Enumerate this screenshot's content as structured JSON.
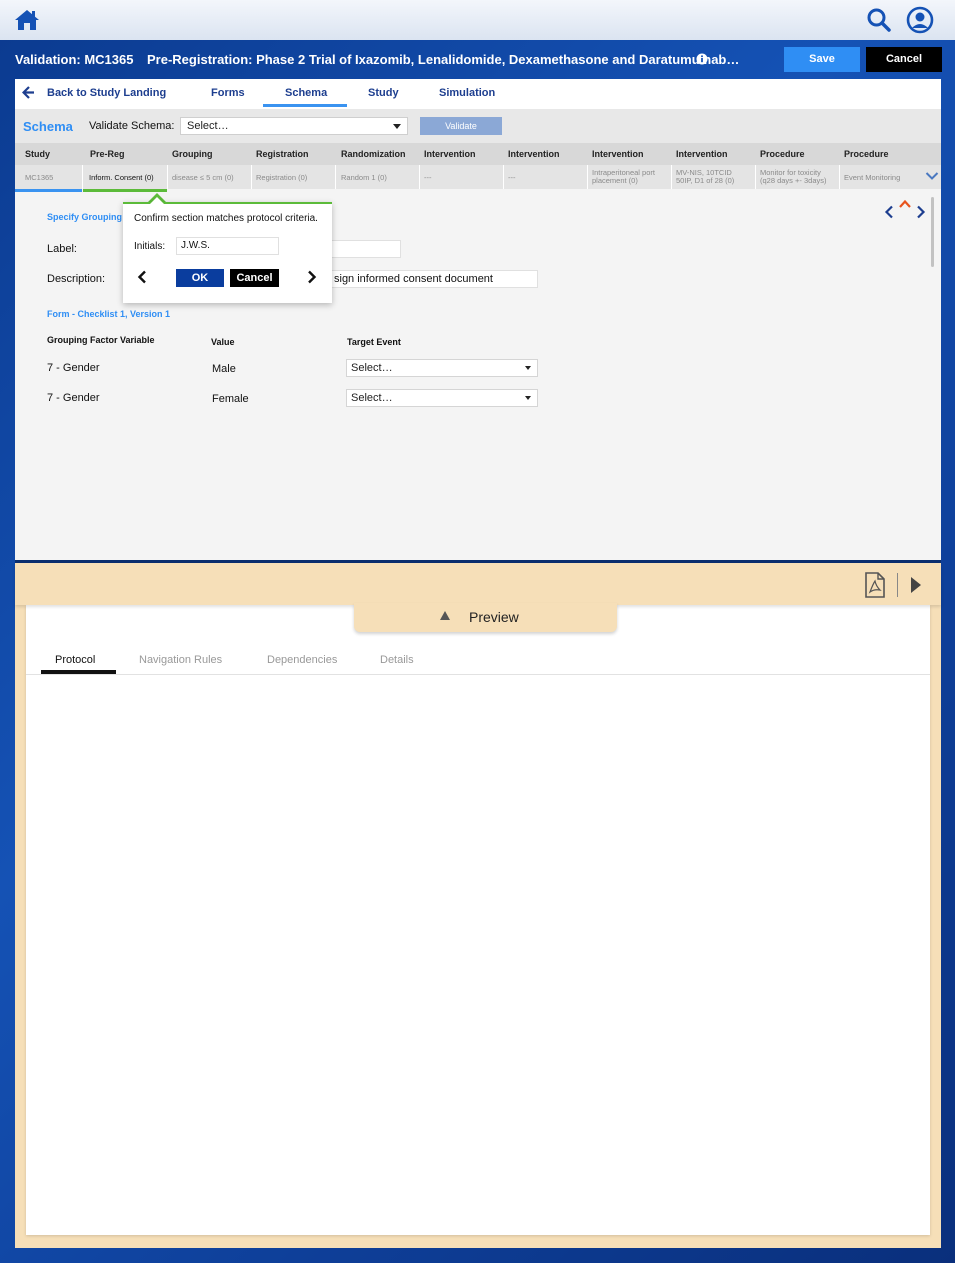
{
  "header": {
    "validation_title": "Validation: MC1365",
    "protocol_title": "Pre-Registration: Phase 2 Trial of Ixazomib, Lenalidomide, Dexamethasone and Daratumumab…",
    "save_label": "Save",
    "cancel_label": "Cancel"
  },
  "nav": {
    "back_label": "Back to Study Landing",
    "tabs": [
      "Forms",
      "Schema",
      "Study",
      "Simulation"
    ],
    "active_tab": "Schema"
  },
  "schema_bar": {
    "title": "Schema",
    "validate_label": "Validate Schema:",
    "select_value": "Select…",
    "validate_button": "Validate"
  },
  "grid": {
    "headers": [
      "Study",
      "Pre-Reg",
      "Grouping",
      "Registration",
      "Randomization",
      "Intervention",
      "Intervention",
      "Intervention",
      "Intervention",
      "Procedure",
      "Procedure"
    ],
    "cells": {
      "c0": "MC1365",
      "c1": "Inform. Consent (0)",
      "c2": "disease ≤ 5 cm (0)",
      "c3": "Registration (0)",
      "c4": "Random 1 (0)",
      "c5": "---",
      "c6": "---",
      "c7a": "Intraperitoneal port",
      "c7b": "placement (0)",
      "c8a": "MV-NIS, 10TCID",
      "c8b": "50IP, D1 of 28 (0)",
      "c9a": "Monitor for toxicity",
      "c9b": "(q28 days +- 3days)",
      "c10": "Event Monitoring"
    }
  },
  "detail": {
    "specify_grouping": "Specify Grouping",
    "label_label": "Label:",
    "description_label": "Description:",
    "description_value": "sign informed consent document",
    "form_title": "Form - Checklist 1, Version 1",
    "col_variable": "Grouping Factor Variable",
    "col_value": "Value",
    "col_target": "Target Event",
    "rows": [
      {
        "variable": "7 - Gender",
        "value": "Male",
        "target": "Select…"
      },
      {
        "variable": "7 - Gender",
        "value": "Female",
        "target": "Select…"
      }
    ]
  },
  "popover": {
    "message": "Confirm section matches protocol criteria.",
    "initials_label": "Initials:",
    "initials_value": "J.W.S.",
    "ok_label": "OK",
    "cancel_label": "Cancel"
  },
  "preview": {
    "title": "Preview",
    "tabs": [
      "Protocol",
      "Navigation Rules",
      "Dependencies",
      "Details"
    ],
    "active_tab": "Protocol"
  },
  "colors": {
    "accent_blue": "#2f8ef4",
    "nav_blue": "#1d3e8f",
    "ok_blue": "#0a3d9e",
    "green": "#5cbb3a",
    "drawer_tan": "#f6dfb8",
    "orange_caret": "#e8541e"
  },
  "icons": [
    "home-icon",
    "search-icon",
    "user-icon",
    "info-icon",
    "back-arrow-icon",
    "chevron-down-icon",
    "chevron-left-icon",
    "chevron-up-icon",
    "chevron-right-icon",
    "pdf-icon",
    "play-icon",
    "triangle-up-icon"
  ]
}
